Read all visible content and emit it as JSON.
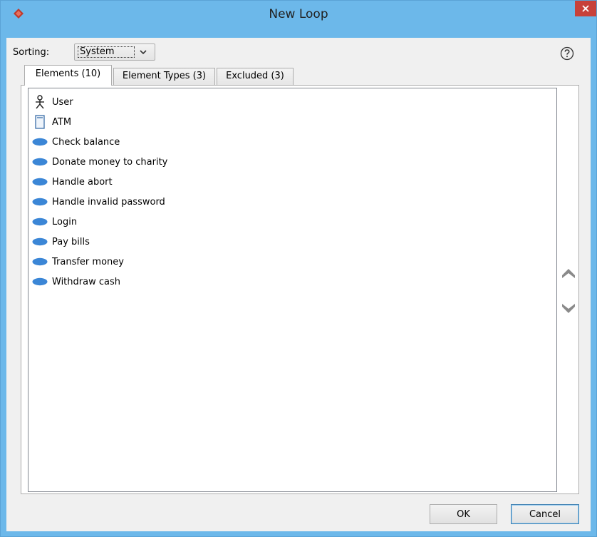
{
  "window": {
    "title": "New Loop",
    "app_icon": "diamond-logo-icon",
    "close_icon": "close-icon"
  },
  "sorting": {
    "label": "Sorting:",
    "selected": "System",
    "dropdown_icon": "chevron-down-icon"
  },
  "help_icon": "help-icon",
  "tabs": [
    {
      "label": "Elements (10)",
      "active": true
    },
    {
      "label": "Element Types (3)",
      "active": false
    },
    {
      "label": "Excluded (3)",
      "active": false
    }
  ],
  "elements": [
    {
      "label": "User",
      "icon": "actor-icon"
    },
    {
      "label": "ATM",
      "icon": "system-icon"
    },
    {
      "label": "Check balance",
      "icon": "use-case-icon"
    },
    {
      "label": "Donate money to charity",
      "icon": "use-case-icon"
    },
    {
      "label": "Handle abort",
      "icon": "use-case-icon"
    },
    {
      "label": "Handle invalid password",
      "icon": "use-case-icon"
    },
    {
      "label": "Login",
      "icon": "use-case-icon"
    },
    {
      "label": "Pay bills",
      "icon": "use-case-icon"
    },
    {
      "label": "Transfer money",
      "icon": "use-case-icon"
    },
    {
      "label": "Withdraw cash",
      "icon": "use-case-icon"
    }
  ],
  "side_controls": {
    "up_icon": "move-up-icon",
    "down_icon": "move-down-icon"
  },
  "buttons": {
    "ok": "OK",
    "cancel": "Cancel"
  },
  "colors": {
    "title_bar": "#6cb8ea",
    "close_button": "#c7413a",
    "use_case": "#3b86d6"
  }
}
